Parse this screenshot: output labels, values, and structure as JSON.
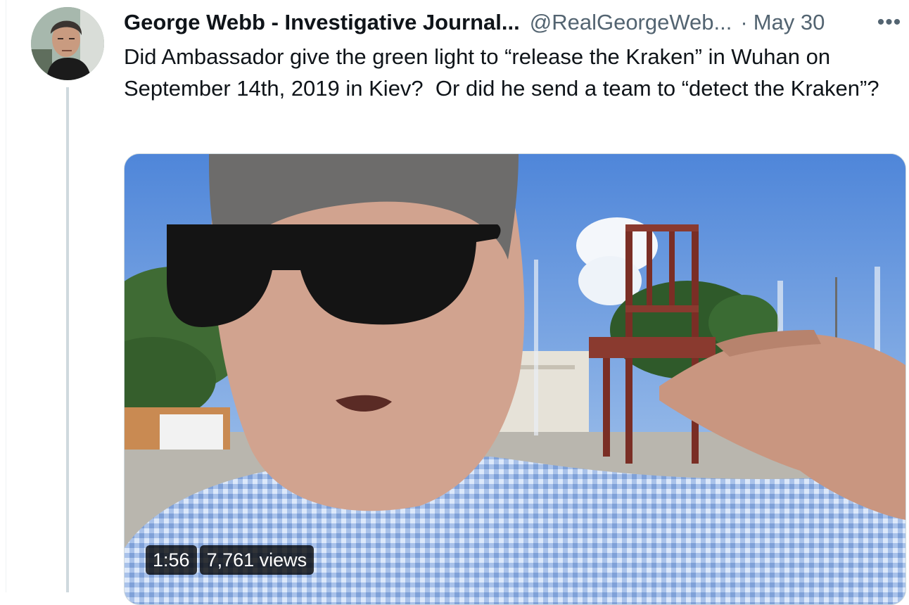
{
  "tweet": {
    "author": {
      "display_name": "George Webb - Investigative Journal...",
      "handle": "@RealGeorgeWeb...",
      "date_separator": "·",
      "date": "May 30"
    },
    "more_icon": "more-horizontal-icon",
    "text": "Did Ambassador give the green light to “release the Kraken” in Wuhan on September 14th, 2019 in Kiev?  Or did he send a team to “detect the Kraken”?",
    "video": {
      "duration": "1:56",
      "views": "7,761 views"
    }
  },
  "colors": {
    "name": "#0f1419",
    "secondary": "#536471",
    "thread_line": "#cfd9de",
    "sky": "#6da0de"
  }
}
